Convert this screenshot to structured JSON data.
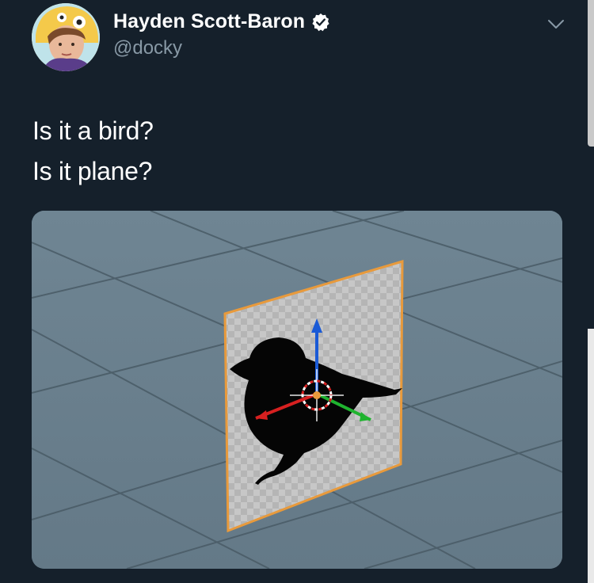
{
  "user": {
    "display_name": "Hayden Scott-Baron",
    "handle": "@docky",
    "verified": true
  },
  "tweet": {
    "lines": [
      "Is it a bird?",
      "Is it plane?"
    ]
  },
  "icons": {
    "verified": "verified-badge-icon",
    "caret": "chevron-down-icon"
  },
  "colors": {
    "background": "#15202b",
    "handle": "#8899a6",
    "viewport": "#687e8d",
    "selection_outline": "#e89a3c",
    "axis_x": "#d62020",
    "axis_y": "#1fb32f",
    "axis_z": "#1a5ad6"
  }
}
